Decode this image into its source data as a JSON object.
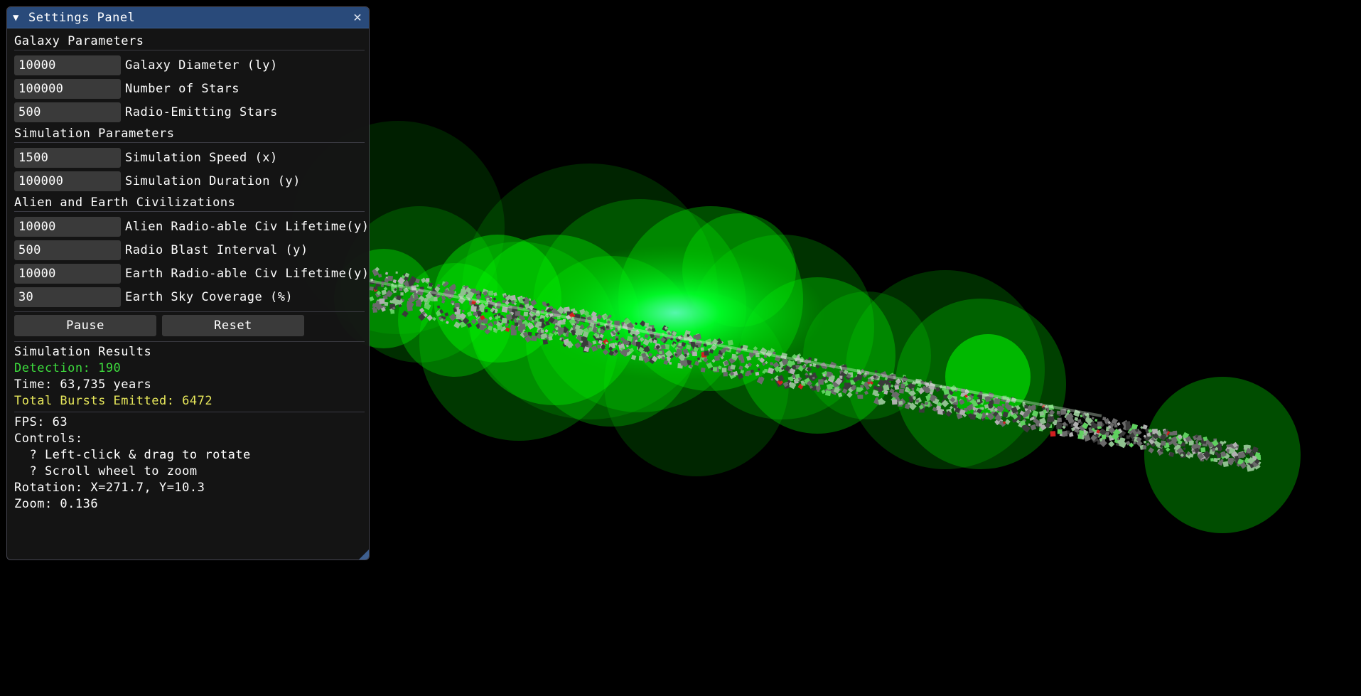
{
  "panel": {
    "title": "Settings Panel",
    "collapse_icon": "▼",
    "close_icon": "✕"
  },
  "sections": {
    "galaxy": "Galaxy Parameters",
    "simulation": "Simulation Parameters",
    "civs": "Alien and Earth Civilizations"
  },
  "fields": {
    "galaxy_diameter": {
      "value": "10000",
      "label": "Galaxy Diameter (ly)"
    },
    "num_stars": {
      "value": "100000",
      "label": "Number of Stars"
    },
    "radio_stars": {
      "value": "500",
      "label": "Radio-Emitting Stars"
    },
    "sim_speed": {
      "value": "1500",
      "label": "Simulation Speed (x)"
    },
    "sim_duration": {
      "value": "100000",
      "label": "Simulation Duration (y)"
    },
    "alien_lifetime": {
      "value": "10000",
      "label": "Alien Radio-able Civ Lifetime(y)"
    },
    "blast_interval": {
      "value": "500",
      "label": "Radio Blast Interval (y)"
    },
    "earth_lifetime": {
      "value": "10000",
      "label": "Earth Radio-able Civ Lifetime(y)"
    },
    "sky_coverage": {
      "value": "30",
      "label": "Earth Sky Coverage (%)"
    }
  },
  "buttons": {
    "pause": "Pause",
    "reset": "Reset"
  },
  "results": {
    "header": "Simulation Results",
    "detection": "Detection: 190",
    "time": "Time: 63,735 years",
    "bursts": "Total Bursts Emitted: 6472",
    "fps": "FPS: 63",
    "controls_header": "Controls:",
    "control_rotate": "  ? Left-click & drag to rotate",
    "control_zoom": "  ? Scroll wheel to zoom",
    "rotation": "Rotation: X=271.7, Y=10.3",
    "zoom": "Zoom: 0.136"
  },
  "colors": {
    "detection": "#3ddc3d",
    "bursts": "#e6e65a",
    "title_bar": "#294a7a",
    "burst_sphere": "#00ff00"
  }
}
